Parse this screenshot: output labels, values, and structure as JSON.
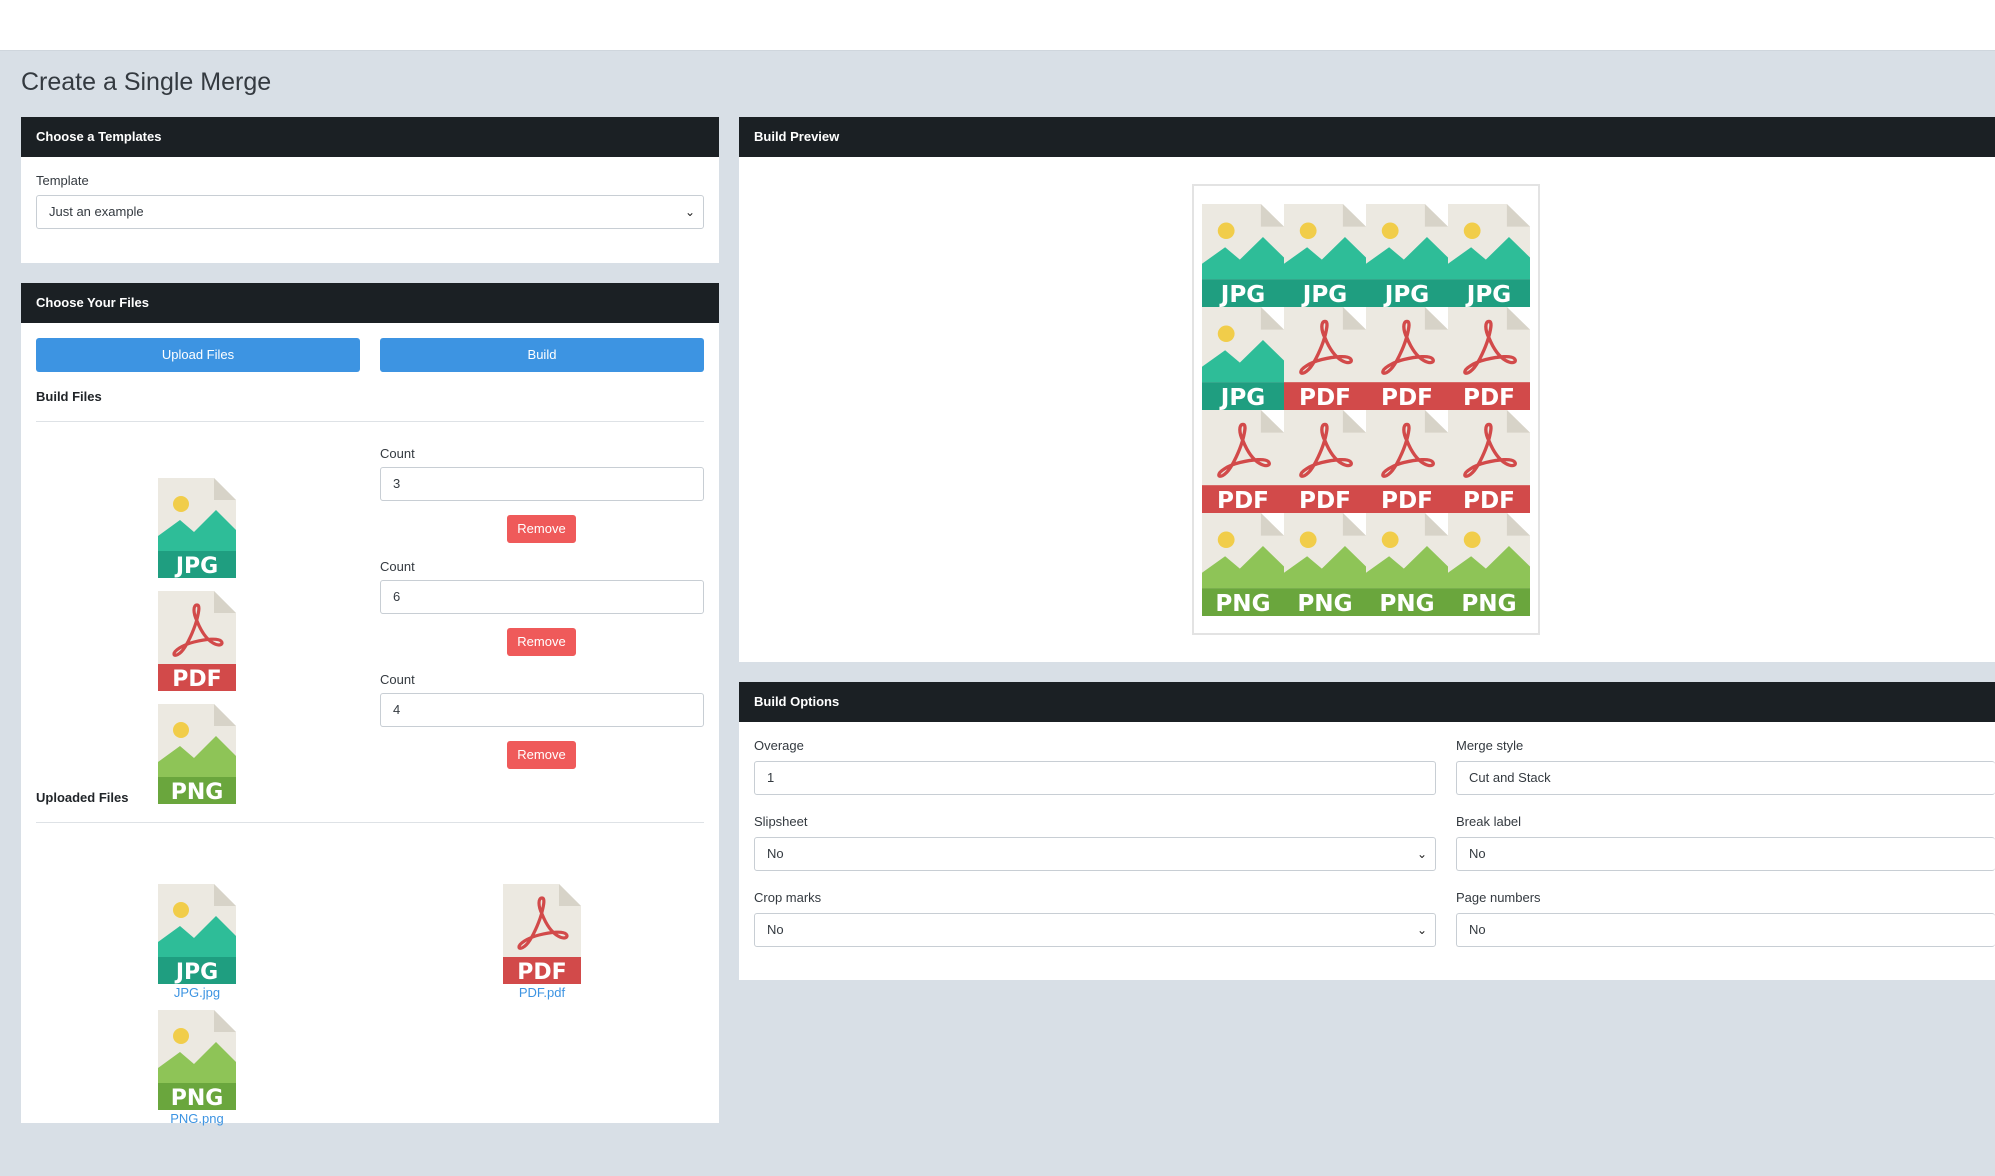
{
  "page": {
    "title": "Create a Single Merge"
  },
  "templates_card": {
    "header": "Choose a Templates",
    "template_label": "Template",
    "template_value": "Just an example"
  },
  "files_card": {
    "header": "Choose Your Files",
    "upload_label": "Upload Files",
    "build_label": "Build",
    "build_files_title": "Build Files",
    "build_files": [
      {
        "type": "JPG",
        "count_label": "Count",
        "count": "3",
        "remove_label": "Remove"
      },
      {
        "type": "PDF",
        "count_label": "Count",
        "count": "6",
        "remove_label": "Remove"
      },
      {
        "type": "PNG",
        "count_label": "Count",
        "count": "4",
        "remove_label": "Remove"
      }
    ],
    "uploaded_files_title": "Uploaded Files",
    "uploaded_files": [
      {
        "type": "JPG",
        "name": "JPG.jpg"
      },
      {
        "type": "PDF",
        "name": "PDF.pdf"
      },
      {
        "type": "PNG",
        "name": "PNG.png"
      }
    ]
  },
  "preview_card": {
    "header": "Build Preview",
    "cells": [
      "JPG",
      "JPG",
      "JPG",
      "JPG",
      "JPG",
      "PDF",
      "PDF",
      "PDF",
      "PDF",
      "PDF",
      "PDF",
      "PDF",
      "PNG",
      "PNG",
      "PNG",
      "PNG"
    ]
  },
  "options_card": {
    "header": "Build Options",
    "overage_label": "Overage",
    "overage_value": "1",
    "merge_style_label": "Merge style",
    "merge_style_value": "Cut and Stack",
    "slipsheet_label": "Slipsheet",
    "slipsheet_value": "No",
    "break_label_label": "Break label",
    "break_label_value": "No",
    "crop_marks_label": "Crop marks",
    "crop_marks_value": "No",
    "page_numbers_label": "Page numbers",
    "page_numbers_value": "No"
  },
  "icons": {
    "JPG": {
      "top": "#2ebd98",
      "band": "#1f9e80",
      "text": "JPG"
    },
    "PNG": {
      "top": "#8ec457",
      "band": "#6aa63d",
      "text": "PNG"
    },
    "PDF": {
      "accent": "#d24a4a",
      "band": "#d24a4a",
      "text": "PDF"
    },
    "paper": "#ece9e1",
    "fold": "#d7d3c8",
    "sun": "#f1cd4a"
  }
}
